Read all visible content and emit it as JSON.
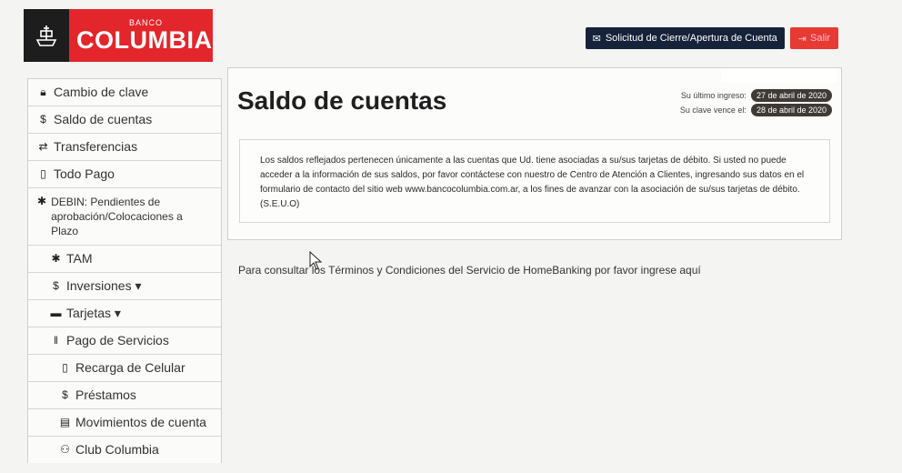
{
  "header": {
    "logo_small": "BANCO",
    "logo_name": "COLUMBIA",
    "solicitud_label": "Solicitud de Cierre/Apertura de Cuenta",
    "salir_label": "Salir"
  },
  "sidebar": {
    "items": [
      {
        "icon": "lock-icon",
        "label": "Cambio de clave"
      },
      {
        "icon": "dollar-icon",
        "label": "Saldo de cuentas"
      },
      {
        "icon": "transfer-icon",
        "label": "Transferencias"
      },
      {
        "icon": "phone-icon",
        "label": "Todo Pago"
      },
      {
        "icon": "star-icon",
        "label": "DEBIN: Pendientes de aprobación/Colocaciones a Plazo"
      },
      {
        "icon": "star-icon",
        "label": "TAM"
      },
      {
        "icon": "dollar-icon",
        "label": "Inversiones ▾"
      },
      {
        "icon": "card-icon",
        "label": "Tarjetas ▾"
      },
      {
        "icon": "barcode-icon",
        "label": "Pago de Servicios"
      },
      {
        "icon": "phone-icon",
        "label": "Recarga de Celular"
      },
      {
        "icon": "dollar-icon",
        "label": "Préstamos"
      },
      {
        "icon": "list-icon",
        "label": "Movimientos de cuenta"
      },
      {
        "icon": "people-icon",
        "label": "Club Columbia"
      }
    ]
  },
  "main": {
    "title": "Saldo de cuentas",
    "ultimo_ingreso_label": "Su último ingreso:",
    "ultimo_ingreso_value": "27 de abril de 2020",
    "clave_vence_label": "Su clave vence el:",
    "clave_vence_value": "28 de abril de 2020",
    "info_text": "Los saldos reflejados pertenecen únicamente a las cuentas que Ud. tiene asociadas a su/sus tarjetas de débito. Si usted no puede acceder a la información de sus saldos, por favor contáctese con nuestro de Centro de Atención a Clientes, ingresando sus datos en el formulario de contacto del sitio web www.bancocolumbia.com.ar, a los fines de avanzar con la asociación de su/sus tarjetas de débito. (S.E.U.O)",
    "terms_text": "Para consultar los Términos y Condiciones del Servicio de HomeBanking por favor ingrese aquí"
  },
  "colors": {
    "brand_red": "#e3262b",
    "emblem_dark": "#1d1d1d",
    "button_navy": "#16223a"
  }
}
